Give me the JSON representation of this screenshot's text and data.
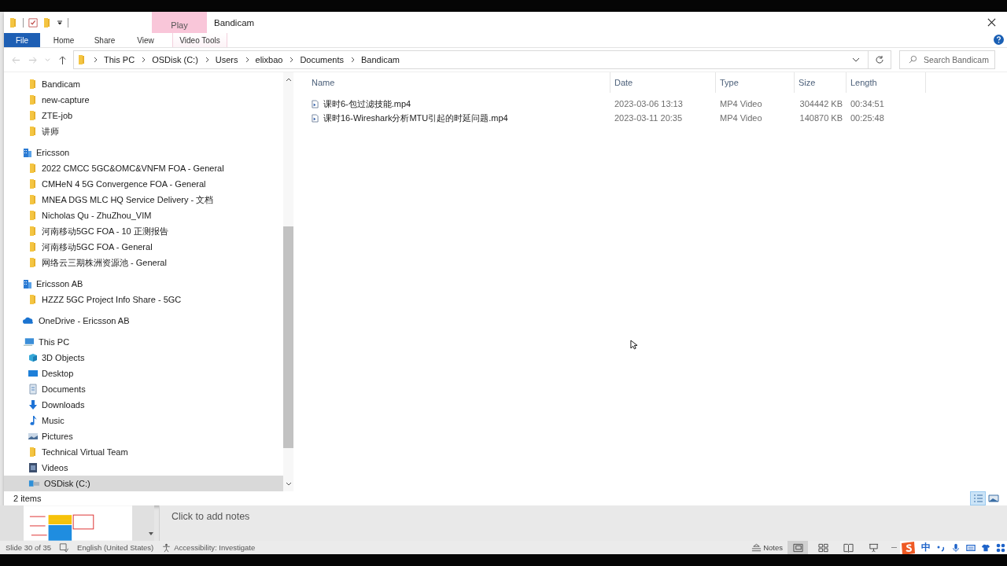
{
  "explorer": {
    "title": "Bandicam",
    "context_tab": "Play",
    "ribbon_tabs": [
      {
        "label": "File",
        "kind": "file"
      },
      {
        "label": "Home",
        "kind": "tab"
      },
      {
        "label": "Share",
        "kind": "tab"
      },
      {
        "label": "View",
        "kind": "tab"
      },
      {
        "label": "Video Tools",
        "kind": "context"
      }
    ],
    "breadcrumbs": [
      "This PC",
      "OSDisk (C:)",
      "Users",
      "elixbao",
      "Documents",
      "Bandicam"
    ],
    "search": {
      "placeholder": "Search Bandicam"
    },
    "nav_pane": {
      "continued_items": [
        {
          "label": "Bandicam",
          "kind": "folder",
          "selected": false
        },
        {
          "label": "new-capture",
          "kind": "folder",
          "selected": false
        },
        {
          "label": "ZTE-job",
          "kind": "folder",
          "selected": false
        },
        {
          "label": "讲师",
          "kind": "folder",
          "selected": false
        }
      ],
      "groups": [
        {
          "label": "Ericsson",
          "kind": "org",
          "selected": false,
          "children": [
            {
              "label": "2022 CMCC 5GC&OMC&VNFM FOA - General",
              "kind": "folder",
              "selected": false
            },
            {
              "label": "CMHeN 4 5G Convergence FOA - General",
              "kind": "folder",
              "selected": false
            },
            {
              "label": "MNEA DGS MLC HQ Service Delivery - 文档",
              "kind": "folder",
              "selected": false
            },
            {
              "label": "Nicholas Qu - ZhuZhou_VIM",
              "kind": "folder",
              "selected": false
            },
            {
              "label": "河南移动5GC FOA - 10 正测报告",
              "kind": "folder",
              "selected": false
            },
            {
              "label": "河南移动5GC FOA - General",
              "kind": "folder",
              "selected": false
            },
            {
              "label": "网络云三期株洲资源池 - General",
              "kind": "folder",
              "selected": false
            }
          ]
        },
        {
          "label": "Ericsson AB",
          "kind": "org",
          "selected": false,
          "children": [
            {
              "label": "HZZZ 5GC Project Info Share - 5GC",
              "kind": "folder",
              "selected": false
            }
          ]
        },
        {
          "label": "OneDrive - Ericsson AB",
          "kind": "cloud",
          "selected": false
        },
        {
          "label": "This PC",
          "kind": "pc",
          "selected": false,
          "children": [
            {
              "label": "3D Objects",
              "kind": "cube",
              "selected": false
            },
            {
              "label": "Desktop",
              "kind": "desktop",
              "selected": false
            },
            {
              "label": "Documents",
              "kind": "document",
              "selected": false
            },
            {
              "label": "Downloads",
              "kind": "download",
              "selected": false
            },
            {
              "label": "Music",
              "kind": "music",
              "selected": false
            },
            {
              "label": "Pictures",
              "kind": "pictures",
              "selected": false
            },
            {
              "label": "Technical Virtual Team",
              "kind": "folder",
              "selected": false
            },
            {
              "label": "Videos",
              "kind": "videos",
              "selected": false
            },
            {
              "label": "OSDisk (C:)",
              "kind": "disk",
              "selected": true
            }
          ]
        }
      ]
    },
    "columns": [
      "Name",
      "Date",
      "Type",
      "Size",
      "Length"
    ],
    "rows": [
      {
        "name": "课时6-包过滤技能.mp4",
        "date": "2023-03-06 13:13",
        "type": "MP4 Video",
        "size": "304442 KB",
        "length": "00:34:51"
      },
      {
        "name": "课时16-Wireshark分析MTU引起的时延问题.mp4",
        "date": "2023-03-11 20:35",
        "type": "MP4 Video",
        "size": "140870 KB",
        "length": "00:25:48"
      }
    ],
    "status": "2 items",
    "views": [
      {
        "kind": "details",
        "selected": true
      },
      {
        "kind": "thumbnails",
        "selected": false
      }
    ]
  },
  "powerpoint": {
    "notes_placeholder": "Click to add notes",
    "status": {
      "slide": "Slide 30 of 35",
      "language": "English (United States)",
      "accessibility": "Accessibility: Investigate",
      "notes": "Notes"
    },
    "views": [
      {
        "kind": "normal",
        "selected": true
      },
      {
        "kind": "sorter",
        "selected": false
      },
      {
        "kind": "reading",
        "selected": false
      },
      {
        "kind": "slideshow",
        "selected": false
      }
    ],
    "ime_mode": "中"
  }
}
